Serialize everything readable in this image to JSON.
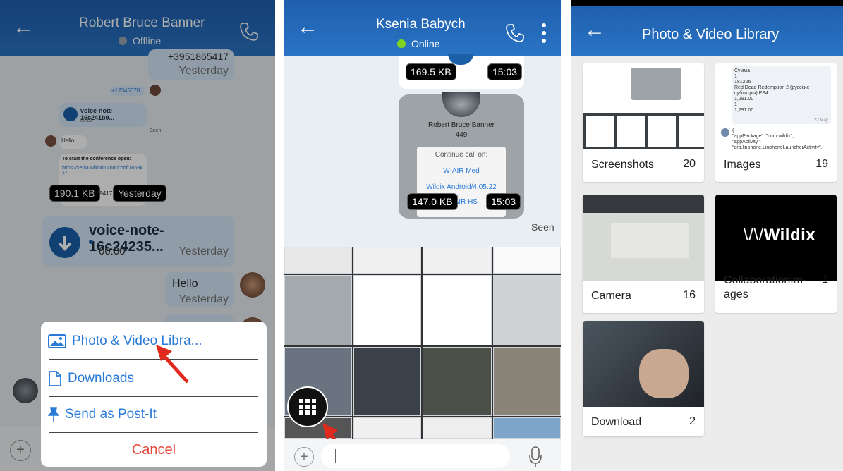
{
  "panel1": {
    "contact_name": "Robert Bruce Banner",
    "status": "Offline",
    "number_partial": "+3951865417",
    "yesterday": "Yesterday",
    "mini_number": "+12345678",
    "voice_note_small": "voice-note-16c241b9...",
    "voice_small_time": "00:03",
    "seen": "Seen",
    "hello_small": "Hello",
    "conference_title": "To start the conference open:",
    "conference_link": "https://xenia.wildixin.com/conf/1669417",
    "file_size": "190.1 KB",
    "file_partial": "1669417",
    "voice_note": "voice-note-16c24235...",
    "voice_time": "00:00",
    "hello": "Hello",
    "menu": {
      "photo_video": "Photo & Video Libra...",
      "downloads": "Downloads",
      "post_it": "Send as Post-It",
      "cancel": "Cancel"
    }
  },
  "panel2": {
    "contact_name": "Ksenia Babych",
    "status": "Online",
    "size1": "169.5 KB",
    "time1": "15:03",
    "card_name": "Robert Bruce Banner",
    "card_ext": "449",
    "continue_call": "Continue call on:",
    "option1": "W-AIR Med",
    "option2": "Wildix Android/4.05.22",
    "option3": "W-AIR HS",
    "size2": "147.0 KB",
    "time2": "15:03",
    "seen": "Seen"
  },
  "panel3": {
    "title": "Photo & Video Library",
    "albums": [
      {
        "name": "Screenshots",
        "count": "20"
      },
      {
        "name": "Images",
        "count": "19"
      },
      {
        "name": "Camera",
        "count": "16"
      },
      {
        "name": "CollaborationIm-ages",
        "count": "1"
      },
      {
        "name": "Download",
        "count": "2"
      }
    ],
    "wildix_logo": "Wildix",
    "images_text": "Сумма\n1\n181226\nRed Dead Redemption 2 (русские субтитры) PS4\n1,291.00\n1\n1,291.00",
    "images_date": "22 May",
    "images_json": "{\n\"appPackage\": \"com.wildix\",\n\"appActivity\": \"org.linphone.LinphoneLauncherActivity\","
  },
  "colors": {
    "header_blue": "#2a6cbd",
    "accent": "#2a7ad8",
    "cancel_red": "#e8473c",
    "arrow_red": "#e02a1e",
    "online": "#7ed321"
  }
}
